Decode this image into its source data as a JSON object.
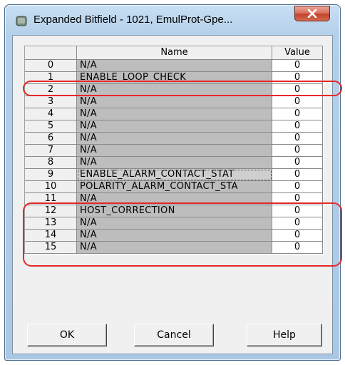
{
  "window": {
    "title": "Expanded Bitfield - 1021, EmulProt-Gpe...",
    "close_symbol": "X"
  },
  "grid": {
    "headers": {
      "index": "",
      "name": "Name",
      "value": "Value"
    },
    "rows": [
      {
        "index": "0",
        "name": "N/A",
        "value": "0"
      },
      {
        "index": "1",
        "name": "ENABLE_LOOP_CHECK",
        "value": "0"
      },
      {
        "index": "2",
        "name": "N/A",
        "value": "0"
      },
      {
        "index": "3",
        "name": "N/A",
        "value": "0"
      },
      {
        "index": "4",
        "name": "N/A",
        "value": "0"
      },
      {
        "index": "5",
        "name": "N/A",
        "value": "0"
      },
      {
        "index": "6",
        "name": "N/A",
        "value": "0"
      },
      {
        "index": "7",
        "name": "N/A",
        "value": "0"
      },
      {
        "index": "8",
        "name": "N/A",
        "value": "0"
      },
      {
        "index": "9",
        "name": "ENABLE_ALARM_CONTACT_STAT",
        "value": "0"
      },
      {
        "index": "10",
        "name": "POLARITY_ALARM_CONTACT_STA",
        "value": "0"
      },
      {
        "index": "11",
        "name": "N/A",
        "value": "0"
      },
      {
        "index": "12",
        "name": "HOST_CORRECTION",
        "value": "0"
      },
      {
        "index": "13",
        "name": "N/A",
        "value": "0"
      },
      {
        "index": "14",
        "name": "N/A",
        "value": "0"
      },
      {
        "index": "15",
        "name": "N/A",
        "value": "0"
      }
    ]
  },
  "buttons": {
    "ok": "OK",
    "cancel": "Cancel",
    "help": "Help"
  },
  "colors": {
    "annotation": "#e52828",
    "name_cell": "#bdbdbd",
    "dialog_face": "#f0f0f0"
  }
}
